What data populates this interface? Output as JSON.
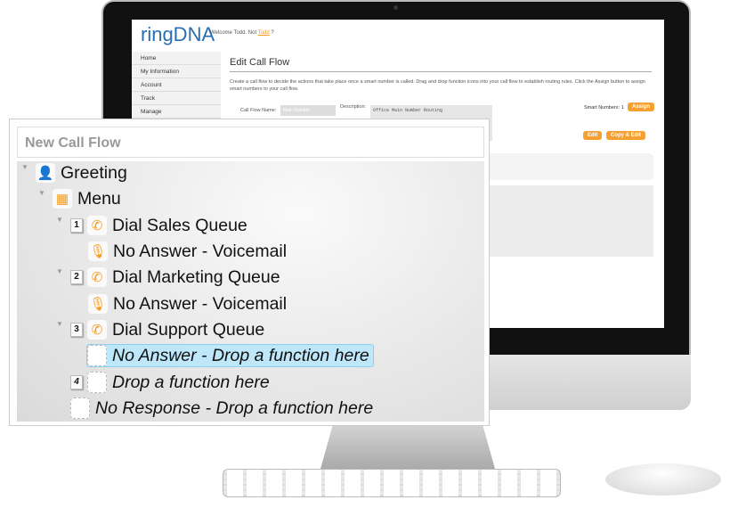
{
  "app": {
    "logo": "ringDNA",
    "welcome_prefix": "Welcome Todd. Not ",
    "welcome_link": "Todd",
    "welcome_suffix": "?"
  },
  "sidebar": {
    "items": [
      {
        "label": "Home"
      },
      {
        "label": "My Information"
      },
      {
        "label": "Account"
      },
      {
        "label": "Track"
      },
      {
        "label": "Manage"
      }
    ]
  },
  "main": {
    "title": "Edit Call Flow",
    "description": "Create a call flow to decide the actions that take place once a smart number is called. Drag and drop function icons into your call flow to establish routing rules. Click the Assign button to assign smart numbers to your call flow.",
    "call_flow_name_label": "Call Flow Name:",
    "call_flow_name_value": "Main Number",
    "description_label": "Description:",
    "description_value": "Office Main Number Routing",
    "smart_numbers": "Smart Numbers: 1",
    "assign": "Assign",
    "edit": "Edit",
    "copy_edit": "Copy & Edit"
  },
  "panel": {
    "title": "New Call Flow",
    "rows": [
      {
        "label": "Greeting",
        "icon": "person-icon"
      },
      {
        "label": "Menu",
        "icon": "keypad-icon"
      },
      {
        "num": "1",
        "label": "Dial Sales Queue",
        "icon": "phone-icon"
      },
      {
        "label": "No Answer - Voicemail",
        "icon": "microphone-icon"
      },
      {
        "num": "2",
        "label": "Dial Marketing Queue",
        "icon": "phone-icon"
      },
      {
        "label": "No Answer - Voicemail",
        "icon": "microphone-icon"
      },
      {
        "num": "3",
        "label": "Dial Support Queue",
        "icon": "phone-icon"
      },
      {
        "label": "No Answer - Drop a function here",
        "icon": "empty-slot"
      },
      {
        "num": "4",
        "label": "Drop a function here",
        "icon": "empty-slot"
      },
      {
        "label": "No Response - Drop a function here",
        "icon": "empty-slot"
      }
    ]
  },
  "colors": {
    "accent": "#f39a1e",
    "highlight": "#bfe7fa"
  }
}
